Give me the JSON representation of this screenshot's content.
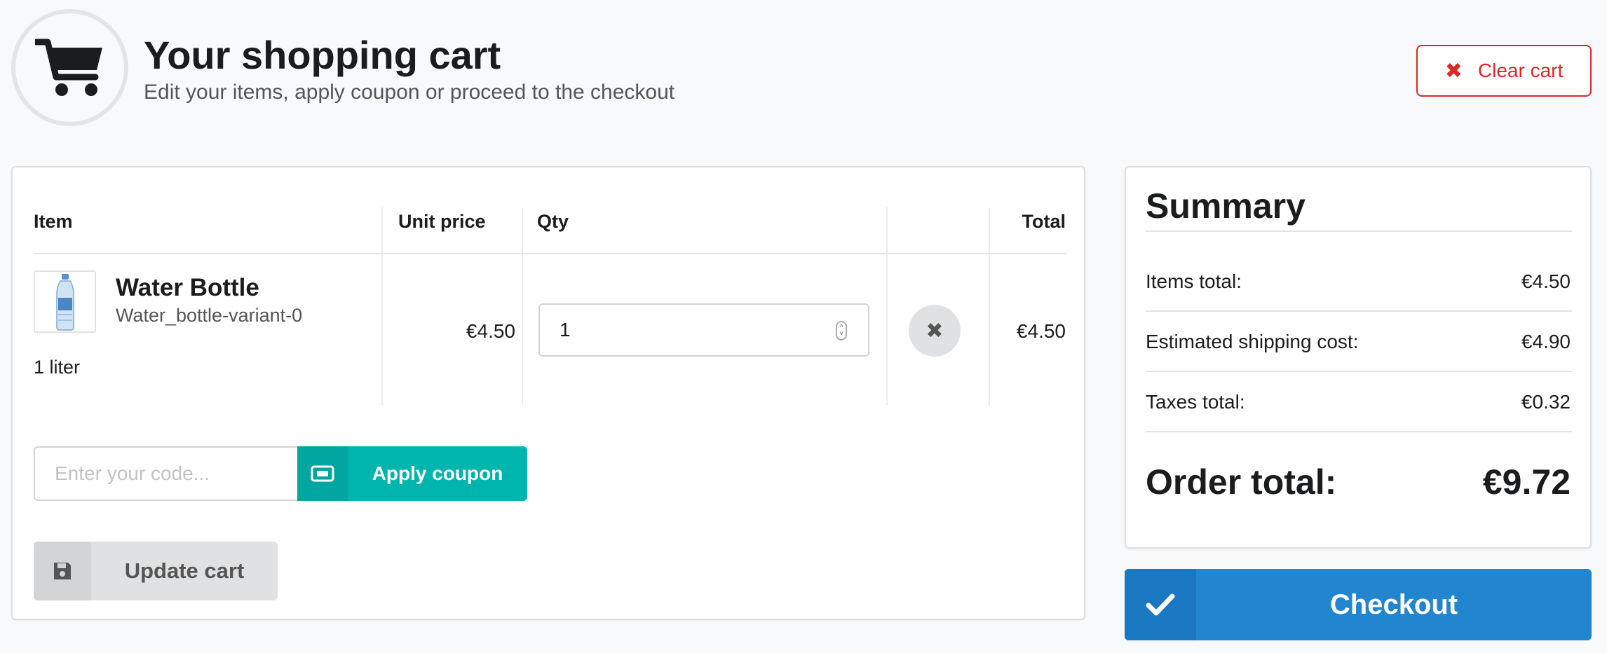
{
  "header": {
    "title": "Your shopping cart",
    "subtitle": "Edit your items, apply coupon or proceed to the checkout",
    "clear_label": "Clear cart"
  },
  "cart": {
    "columns": {
      "item": "Item",
      "unit_price": "Unit price",
      "qty": "Qty",
      "total": "Total"
    },
    "items": [
      {
        "name": "Water Bottle",
        "variant": "Water_bottle-variant-0",
        "option": "1 liter",
        "unit_price": "€4.50",
        "qty": "1",
        "total": "€4.50"
      }
    ],
    "coupon": {
      "placeholder": "Enter your code...",
      "button_label": "Apply coupon"
    },
    "update_label": "Update cart"
  },
  "summary": {
    "title": "Summary",
    "rows": [
      {
        "label": "Items total:",
        "value": "€4.50"
      },
      {
        "label": "Estimated shipping cost:",
        "value": "€4.90"
      },
      {
        "label": "Taxes total:",
        "value": "€0.32"
      }
    ],
    "order_total_label": "Order total:",
    "order_total_value": "€9.72"
  },
  "checkout_label": "Checkout",
  "colors": {
    "teal": "#00b5ad",
    "blue": "#2185d0",
    "red": "#db2828"
  }
}
